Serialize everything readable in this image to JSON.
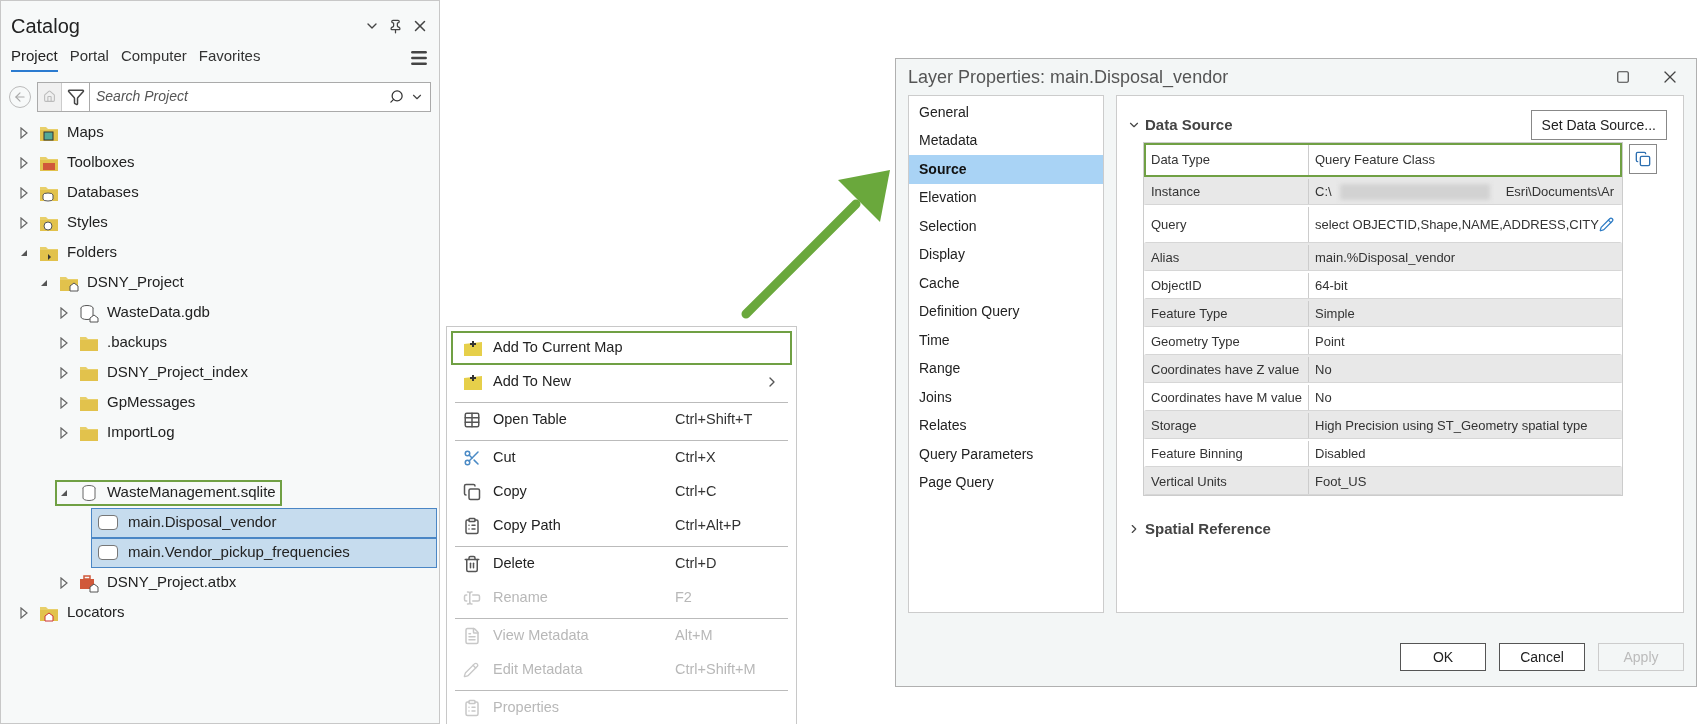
{
  "catalog": {
    "title": "Catalog",
    "tabs": [
      {
        "label": "Project",
        "selected": true
      },
      {
        "label": "Portal",
        "selected": false
      },
      {
        "label": "Computer",
        "selected": false
      },
      {
        "label": "Favorites",
        "selected": false
      }
    ],
    "search": {
      "placeholder": "Search Project"
    },
    "tree": [
      {
        "label": "Maps",
        "kind": "maps",
        "expanded": false,
        "selected": false,
        "highlighted": false
      },
      {
        "label": "Toolboxes",
        "kind": "toolboxes",
        "expanded": false,
        "selected": false,
        "highlighted": false
      },
      {
        "label": "Databases",
        "kind": "databases",
        "expanded": false,
        "selected": false,
        "highlighted": false
      },
      {
        "label": "Styles",
        "kind": "styles",
        "expanded": false,
        "selected": false,
        "highlighted": false
      },
      {
        "label": "Folders",
        "kind": "folders",
        "expanded": true,
        "selected": false,
        "highlighted": false,
        "children": [
          {
            "label": "DSNY_Project",
            "kind": "homefolder",
            "expanded": true,
            "selected": false,
            "highlighted": false,
            "children": [
              {
                "label": "WasteData.gdb",
                "kind": "gdb",
                "expanded": false,
                "selected": false,
                "highlighted": false
              },
              {
                "label": ".backups",
                "kind": "folder",
                "expanded": false,
                "selected": false,
                "highlighted": false
              },
              {
                "label": "DSNY_Project_index",
                "kind": "folder",
                "expanded": false,
                "selected": false,
                "highlighted": false
              },
              {
                "label": "GpMessages",
                "kind": "folder",
                "expanded": false,
                "selected": false,
                "highlighted": false
              },
              {
                "label": "ImportLog",
                "kind": "folder",
                "expanded": false,
                "selected": false,
                "highlighted": false
              },
              {
                "label": "WasteManagement.sqlite",
                "kind": "sqlite",
                "expanded": true,
                "selected": false,
                "highlighted": true,
                "children": [
                  {
                    "label": "main.Disposal_vendor",
                    "kind": "layer",
                    "selected": true,
                    "highlighted": false
                  },
                  {
                    "label": "main.Vendor_pickup_frequencies",
                    "kind": "layer",
                    "selected": true,
                    "highlighted": false
                  }
                ]
              },
              {
                "label": "DSNY_Project.atbx",
                "kind": "atbx",
                "expanded": false,
                "selected": false,
                "highlighted": false
              }
            ]
          }
        ]
      },
      {
        "label": "Locators",
        "kind": "locators",
        "expanded": false,
        "selected": false,
        "highlighted": false
      }
    ]
  },
  "context_menu": {
    "items": [
      {
        "label": "Add To Current Map",
        "kind": "addmap",
        "disabled": false,
        "highlighted": true,
        "submenu": false,
        "separator_before": false
      },
      {
        "label": "Add To New",
        "kind": "addmap",
        "disabled": false,
        "highlighted": false,
        "submenu": true,
        "separator_before": false
      },
      {
        "label": "Open Table",
        "shortcut": "Ctrl+Shift+T",
        "kind": "table",
        "disabled": false,
        "highlighted": false,
        "submenu": false,
        "separator_before": true
      },
      {
        "label": "Cut",
        "shortcut": "Ctrl+X",
        "kind": "cut",
        "disabled": false,
        "highlighted": false,
        "submenu": false,
        "separator_before": true
      },
      {
        "label": "Copy",
        "shortcut": "Ctrl+C",
        "kind": "copy",
        "disabled": false,
        "highlighted": false,
        "submenu": false,
        "separator_before": false
      },
      {
        "label": "Copy Path",
        "shortcut": "Ctrl+Alt+P",
        "kind": "copypath",
        "disabled": false,
        "highlighted": false,
        "submenu": false,
        "separator_before": false
      },
      {
        "label": "Delete",
        "shortcut": "Ctrl+D",
        "kind": "delete",
        "disabled": false,
        "highlighted": false,
        "submenu": false,
        "separator_before": true
      },
      {
        "label": "Rename",
        "shortcut": "F2",
        "kind": "rename",
        "disabled": true,
        "highlighted": false,
        "submenu": false,
        "separator_before": false
      },
      {
        "label": "View Metadata",
        "shortcut": "Alt+M",
        "kind": "metadata",
        "disabled": true,
        "highlighted": false,
        "submenu": false,
        "separator_before": true
      },
      {
        "label": "Edit Metadata",
        "shortcut": "Ctrl+Shift+M",
        "kind": "edit",
        "disabled": true,
        "highlighted": false,
        "submenu": false,
        "separator_before": false
      },
      {
        "label": "Properties",
        "kind": "properties",
        "disabled": true,
        "highlighted": false,
        "submenu": false,
        "separator_before": true
      }
    ]
  },
  "dialog": {
    "title": "Layer Properties: main.Disposal_vendor",
    "nav": [
      {
        "label": "General",
        "selected": false
      },
      {
        "label": "Metadata",
        "selected": false
      },
      {
        "label": "Source",
        "selected": true
      },
      {
        "label": "Elevation",
        "selected": false
      },
      {
        "label": "Selection",
        "selected": false
      },
      {
        "label": "Display",
        "selected": false
      },
      {
        "label": "Cache",
        "selected": false
      },
      {
        "label": "Definition Query",
        "selected": false
      },
      {
        "label": "Time",
        "selected": false
      },
      {
        "label": "Range",
        "selected": false
      },
      {
        "label": "Joins",
        "selected": false
      },
      {
        "label": "Relates",
        "selected": false
      },
      {
        "label": "Query Parameters",
        "selected": false
      },
      {
        "label": "Page Query",
        "selected": false
      }
    ],
    "sections": [
      {
        "title": "Data Source",
        "expanded": true,
        "button": "Set Data Source...",
        "rows": [
          {
            "label": "Data Type",
            "value": "Query Feature Class",
            "highlighted": true,
            "editable": false,
            "redacted": false
          },
          {
            "label": "Instance",
            "value": "C:\\",
            "value_tail": "Esri\\Documents\\Ar",
            "highlighted": false,
            "editable": false,
            "redacted": true
          },
          {
            "label": "Query",
            "value": "select OBJECTID,Shape,NAME,ADDRESS,CITY",
            "highlighted": false,
            "editable": true,
            "redacted": false
          },
          {
            "label": "Alias",
            "value": "main.%Disposal_vendor",
            "highlighted": false,
            "editable": false,
            "redacted": false
          },
          {
            "label": "ObjectID",
            "value": "64-bit",
            "highlighted": false,
            "editable": false,
            "redacted": false
          },
          {
            "label": "Feature Type",
            "value": "Simple",
            "highlighted": false,
            "editable": false,
            "redacted": false
          },
          {
            "label": "Geometry Type",
            "value": "Point",
            "highlighted": false,
            "editable": false,
            "redacted": false
          },
          {
            "label": "Coordinates have Z value",
            "value": "No",
            "highlighted": false,
            "editable": false,
            "redacted": false
          },
          {
            "label": "Coordinates have M value",
            "value": "No",
            "highlighted": false,
            "editable": false,
            "redacted": false
          },
          {
            "label": "Storage",
            "value": "High Precision using ST_Geometry spatial type",
            "highlighted": false,
            "editable": false,
            "redacted": false
          },
          {
            "label": "Feature Binning",
            "value": "Disabled",
            "highlighted": false,
            "editable": false,
            "redacted": false
          },
          {
            "label": "Vertical Units",
            "value": "Foot_US",
            "highlighted": false,
            "editable": false,
            "redacted": false
          }
        ]
      },
      {
        "title": "Spatial Reference",
        "expanded": false
      }
    ],
    "buttons": [
      {
        "label": "OK",
        "disabled": false
      },
      {
        "label": "Cancel",
        "disabled": false
      },
      {
        "label": "Apply",
        "disabled": true
      }
    ]
  }
}
